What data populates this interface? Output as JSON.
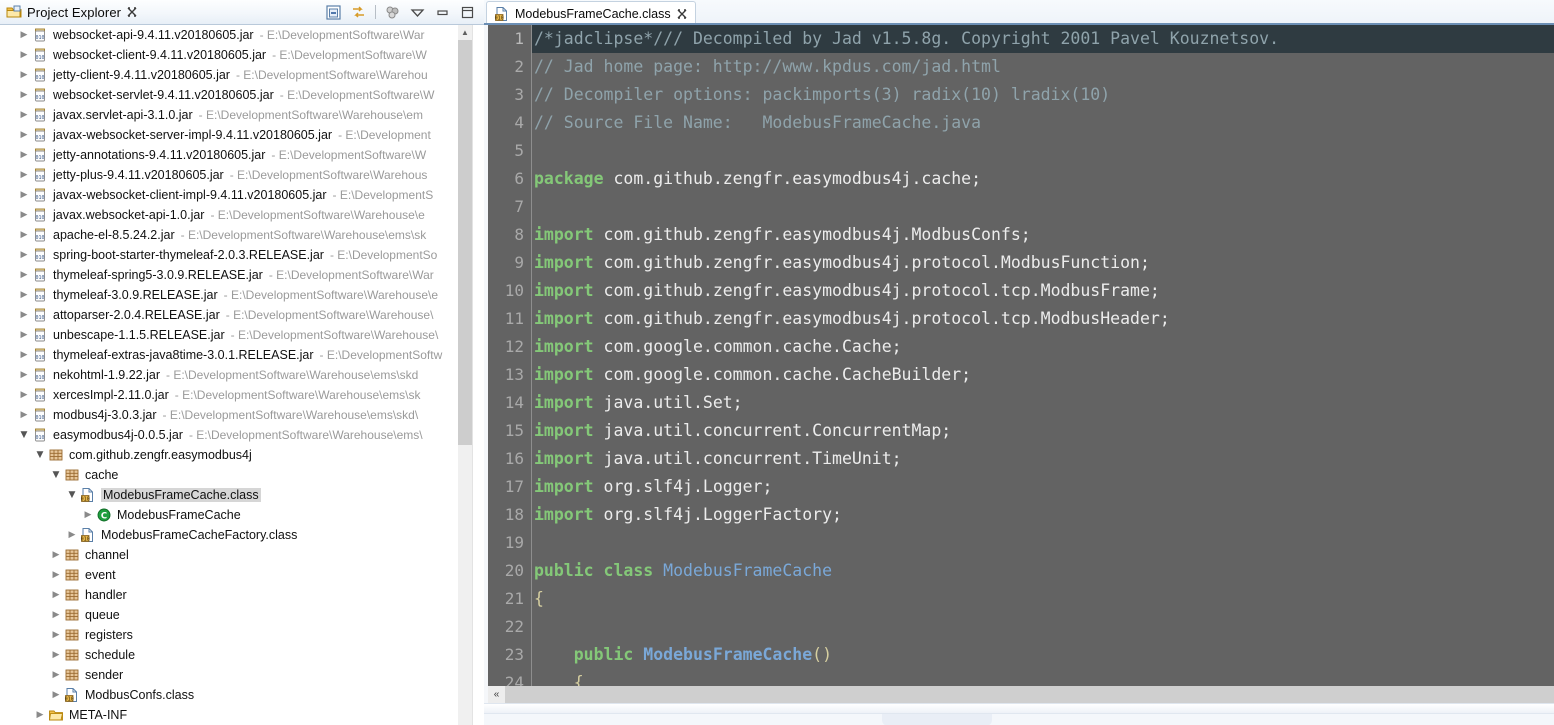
{
  "explorer": {
    "tab_title": "Project Explorer",
    "close_glyph": "✕",
    "toolbar": [
      {
        "name": "collapse-all-icon"
      },
      {
        "name": "link-with-editor-icon"
      },
      {
        "name": "view-filter-icon"
      },
      {
        "name": "view-menu-icon"
      },
      {
        "name": "minimize-icon"
      },
      {
        "name": "maximize-icon"
      }
    ],
    "tree": [
      {
        "indent": 1,
        "arrow": "closed",
        "icon": "jar-icon",
        "label": "websocket-api-9.4.11.v20180605.jar",
        "path": "- E:\\DevelopmentSoftware\\War"
      },
      {
        "indent": 1,
        "arrow": "closed",
        "icon": "jar-icon",
        "label": "websocket-client-9.4.11.v20180605.jar",
        "path": "- E:\\DevelopmentSoftware\\W"
      },
      {
        "indent": 1,
        "arrow": "closed",
        "icon": "jar-icon",
        "label": "jetty-client-9.4.11.v20180605.jar",
        "path": "- E:\\DevelopmentSoftware\\Warehou"
      },
      {
        "indent": 1,
        "arrow": "closed",
        "icon": "jar-icon",
        "label": "websocket-servlet-9.4.11.v20180605.jar",
        "path": "- E:\\DevelopmentSoftware\\W"
      },
      {
        "indent": 1,
        "arrow": "closed",
        "icon": "jar-icon",
        "label": "javax.servlet-api-3.1.0.jar",
        "path": "- E:\\DevelopmentSoftware\\Warehouse\\em"
      },
      {
        "indent": 1,
        "arrow": "closed",
        "icon": "jar-icon",
        "label": "javax-websocket-server-impl-9.4.11.v20180605.jar",
        "path": "- E:\\Development"
      },
      {
        "indent": 1,
        "arrow": "closed",
        "icon": "jar-icon",
        "label": "jetty-annotations-9.4.11.v20180605.jar",
        "path": "- E:\\DevelopmentSoftware\\W"
      },
      {
        "indent": 1,
        "arrow": "closed",
        "icon": "jar-icon",
        "label": "jetty-plus-9.4.11.v20180605.jar",
        "path": "- E:\\DevelopmentSoftware\\Warehous"
      },
      {
        "indent": 1,
        "arrow": "closed",
        "icon": "jar-icon",
        "label": "javax-websocket-client-impl-9.4.11.v20180605.jar",
        "path": "- E:\\DevelopmentS"
      },
      {
        "indent": 1,
        "arrow": "closed",
        "icon": "jar-icon",
        "label": "javax.websocket-api-1.0.jar",
        "path": "- E:\\DevelopmentSoftware\\Warehouse\\e"
      },
      {
        "indent": 1,
        "arrow": "closed",
        "icon": "jar-icon",
        "label": "apache-el-8.5.24.2.jar",
        "path": "- E:\\DevelopmentSoftware\\Warehouse\\ems\\sk"
      },
      {
        "indent": 1,
        "arrow": "closed",
        "icon": "jar-icon",
        "label": "spring-boot-starter-thymeleaf-2.0.3.RELEASE.jar",
        "path": "- E:\\DevelopmentSo"
      },
      {
        "indent": 1,
        "arrow": "closed",
        "icon": "jar-icon",
        "label": "thymeleaf-spring5-3.0.9.RELEASE.jar",
        "path": "- E:\\DevelopmentSoftware\\War"
      },
      {
        "indent": 1,
        "arrow": "closed",
        "icon": "jar-icon",
        "label": "thymeleaf-3.0.9.RELEASE.jar",
        "path": "- E:\\DevelopmentSoftware\\Warehouse\\e"
      },
      {
        "indent": 1,
        "arrow": "closed",
        "icon": "jar-icon",
        "label": "attoparser-2.0.4.RELEASE.jar",
        "path": "- E:\\DevelopmentSoftware\\Warehouse\\"
      },
      {
        "indent": 1,
        "arrow": "closed",
        "icon": "jar-icon",
        "label": "unbescape-1.1.5.RELEASE.jar",
        "path": "- E:\\DevelopmentSoftware\\Warehouse\\"
      },
      {
        "indent": 1,
        "arrow": "closed",
        "icon": "jar-icon",
        "label": "thymeleaf-extras-java8time-3.0.1.RELEASE.jar",
        "path": "- E:\\DevelopmentSoftw"
      },
      {
        "indent": 1,
        "arrow": "closed",
        "icon": "jar-icon",
        "label": "nekohtml-1.9.22.jar",
        "path": "- E:\\DevelopmentSoftware\\Warehouse\\ems\\skd"
      },
      {
        "indent": 1,
        "arrow": "closed",
        "icon": "jar-icon",
        "label": "xercesImpl-2.11.0.jar",
        "path": "- E:\\DevelopmentSoftware\\Warehouse\\ems\\sk"
      },
      {
        "indent": 1,
        "arrow": "closed",
        "icon": "jar-icon",
        "label": "modbus4j-3.0.3.jar",
        "path": "- E:\\DevelopmentSoftware\\Warehouse\\ems\\skd\\"
      },
      {
        "indent": 1,
        "arrow": "open",
        "icon": "jar-icon",
        "label": "easymodbus4j-0.0.5.jar",
        "path": "- E:\\DevelopmentSoftware\\Warehouse\\ems\\"
      },
      {
        "indent": 2,
        "arrow": "open",
        "icon": "package-icon",
        "label": "com.github.zengfr.easymodbus4j",
        "path": ""
      },
      {
        "indent": 3,
        "arrow": "open",
        "icon": "package-icon",
        "label": "cache",
        "path": ""
      },
      {
        "indent": 4,
        "arrow": "open",
        "icon": "class-file-icon",
        "label": "ModebusFrameCache.class",
        "path": "",
        "selected": true
      },
      {
        "indent": 5,
        "arrow": "closed",
        "icon": "class-member-icon",
        "label": "ModebusFrameCache",
        "path": ""
      },
      {
        "indent": 4,
        "arrow": "closed",
        "icon": "class-file-icon",
        "label": "ModebusFrameCacheFactory.class",
        "path": ""
      },
      {
        "indent": 3,
        "arrow": "closed",
        "icon": "package-icon",
        "label": "channel",
        "path": ""
      },
      {
        "indent": 3,
        "arrow": "closed",
        "icon": "package-icon",
        "label": "event",
        "path": ""
      },
      {
        "indent": 3,
        "arrow": "closed",
        "icon": "package-icon",
        "label": "handler",
        "path": ""
      },
      {
        "indent": 3,
        "arrow": "closed",
        "icon": "package-icon",
        "label": "queue",
        "path": ""
      },
      {
        "indent": 3,
        "arrow": "closed",
        "icon": "package-icon",
        "label": "registers",
        "path": ""
      },
      {
        "indent": 3,
        "arrow": "closed",
        "icon": "package-icon",
        "label": "schedule",
        "path": ""
      },
      {
        "indent": 3,
        "arrow": "closed",
        "icon": "package-icon",
        "label": "sender",
        "path": ""
      },
      {
        "indent": 3,
        "arrow": "closed",
        "icon": "class-file-icon",
        "label": "ModbusConfs.class",
        "path": ""
      },
      {
        "indent": 2,
        "arrow": "closed",
        "icon": "folder-icon",
        "label": "META-INF",
        "path": ""
      }
    ]
  },
  "editor": {
    "tab_title": "ModebusFrameCache.class",
    "tab_close_glyph": "✕",
    "hscroll_left_glyph": "«",
    "lines": [
      {
        "n": "1",
        "current": true,
        "tokens": [
          {
            "t": "cmt",
            "s": "/*jadclipse*/// Decompiled by Jad v1.5.8g. Copyright 2001 Pavel Kouznetsov."
          }
        ]
      },
      {
        "n": "2",
        "current": false,
        "tokens": [
          {
            "t": "cmt",
            "s": "// Jad home page: http://www.kpdus.com/jad.html"
          }
        ]
      },
      {
        "n": "3",
        "current": false,
        "tokens": [
          {
            "t": "cmt",
            "s": "// Decompiler options: packimports(3) radix(10) lradix(10)"
          }
        ]
      },
      {
        "n": "4",
        "current": false,
        "tokens": [
          {
            "t": "cmt",
            "s": "// Source File Name:   ModebusFrameCache.java"
          }
        ]
      },
      {
        "n": "5",
        "current": false,
        "tokens": []
      },
      {
        "n": "6",
        "current": false,
        "tokens": [
          {
            "t": "kw",
            "s": "package"
          },
          {
            "t": "idn",
            "s": " com.github.zengfr.easymodbus4j.cache;"
          }
        ]
      },
      {
        "n": "7",
        "current": false,
        "tokens": []
      },
      {
        "n": "8",
        "current": false,
        "tokens": [
          {
            "t": "kw",
            "s": "import"
          },
          {
            "t": "idn",
            "s": " com.github.zengfr.easymodbus4j.ModbusConfs;"
          }
        ]
      },
      {
        "n": "9",
        "current": false,
        "tokens": [
          {
            "t": "kw",
            "s": "import"
          },
          {
            "t": "idn",
            "s": " com.github.zengfr.easymodbus4j.protocol.ModbusFunction;"
          }
        ]
      },
      {
        "n": "10",
        "current": false,
        "tokens": [
          {
            "t": "kw",
            "s": "import"
          },
          {
            "t": "idn",
            "s": " com.github.zengfr.easymodbus4j.protocol.tcp.ModbusFrame;"
          }
        ]
      },
      {
        "n": "11",
        "current": false,
        "tokens": [
          {
            "t": "kw",
            "s": "import"
          },
          {
            "t": "idn",
            "s": " com.github.zengfr.easymodbus4j.protocol.tcp.ModbusHeader;"
          }
        ]
      },
      {
        "n": "12",
        "current": false,
        "tokens": [
          {
            "t": "kw",
            "s": "import"
          },
          {
            "t": "idn",
            "s": " com.google.common.cache.Cache;"
          }
        ]
      },
      {
        "n": "13",
        "current": false,
        "tokens": [
          {
            "t": "kw",
            "s": "import"
          },
          {
            "t": "idn",
            "s": " com.google.common.cache.CacheBuilder;"
          }
        ]
      },
      {
        "n": "14",
        "current": false,
        "tokens": [
          {
            "t": "kw",
            "s": "import"
          },
          {
            "t": "idn",
            "s": " java.util.Set;"
          }
        ]
      },
      {
        "n": "15",
        "current": false,
        "tokens": [
          {
            "t": "kw",
            "s": "import"
          },
          {
            "t": "idn",
            "s": " java.util.concurrent.ConcurrentMap;"
          }
        ]
      },
      {
        "n": "16",
        "current": false,
        "tokens": [
          {
            "t": "kw",
            "s": "import"
          },
          {
            "t": "idn",
            "s": " java.util.concurrent.TimeUnit;"
          }
        ]
      },
      {
        "n": "17",
        "current": false,
        "tokens": [
          {
            "t": "kw",
            "s": "import"
          },
          {
            "t": "idn",
            "s": " org.slf4j.Logger;"
          }
        ]
      },
      {
        "n": "18",
        "current": false,
        "tokens": [
          {
            "t": "kw",
            "s": "import"
          },
          {
            "t": "idn",
            "s": " org.slf4j.LoggerFactory;"
          }
        ]
      },
      {
        "n": "19",
        "current": false,
        "tokens": []
      },
      {
        "n": "20",
        "current": false,
        "tokens": [
          {
            "t": "kw",
            "s": "public class"
          },
          {
            "t": "type",
            "s": " ModebusFrameCache"
          }
        ]
      },
      {
        "n": "21",
        "current": false,
        "tokens": [
          {
            "t": "pun",
            "s": "{"
          }
        ]
      },
      {
        "n": "22",
        "current": false,
        "tokens": []
      },
      {
        "n": "23",
        "current": false,
        "tokens": [
          {
            "t": "idn",
            "s": "    "
          },
          {
            "t": "kw",
            "s": "public"
          },
          {
            "t": "typeb",
            "s": " ModebusFrameCache"
          },
          {
            "t": "pun",
            "s": "()"
          }
        ]
      },
      {
        "n": "24",
        "current": false,
        "tokens": [
          {
            "t": "idn",
            "s": "    "
          },
          {
            "t": "pun",
            "s": "{"
          }
        ]
      }
    ]
  },
  "colors": {
    "editor_bg": "#636363",
    "current_line_bg": "#2f3b41",
    "keyword": "#84c878",
    "comment": "#8fa3ab",
    "type": "#7aa8d8",
    "punctuation": "#d6cfa0",
    "selection": "#d6d6d6"
  }
}
